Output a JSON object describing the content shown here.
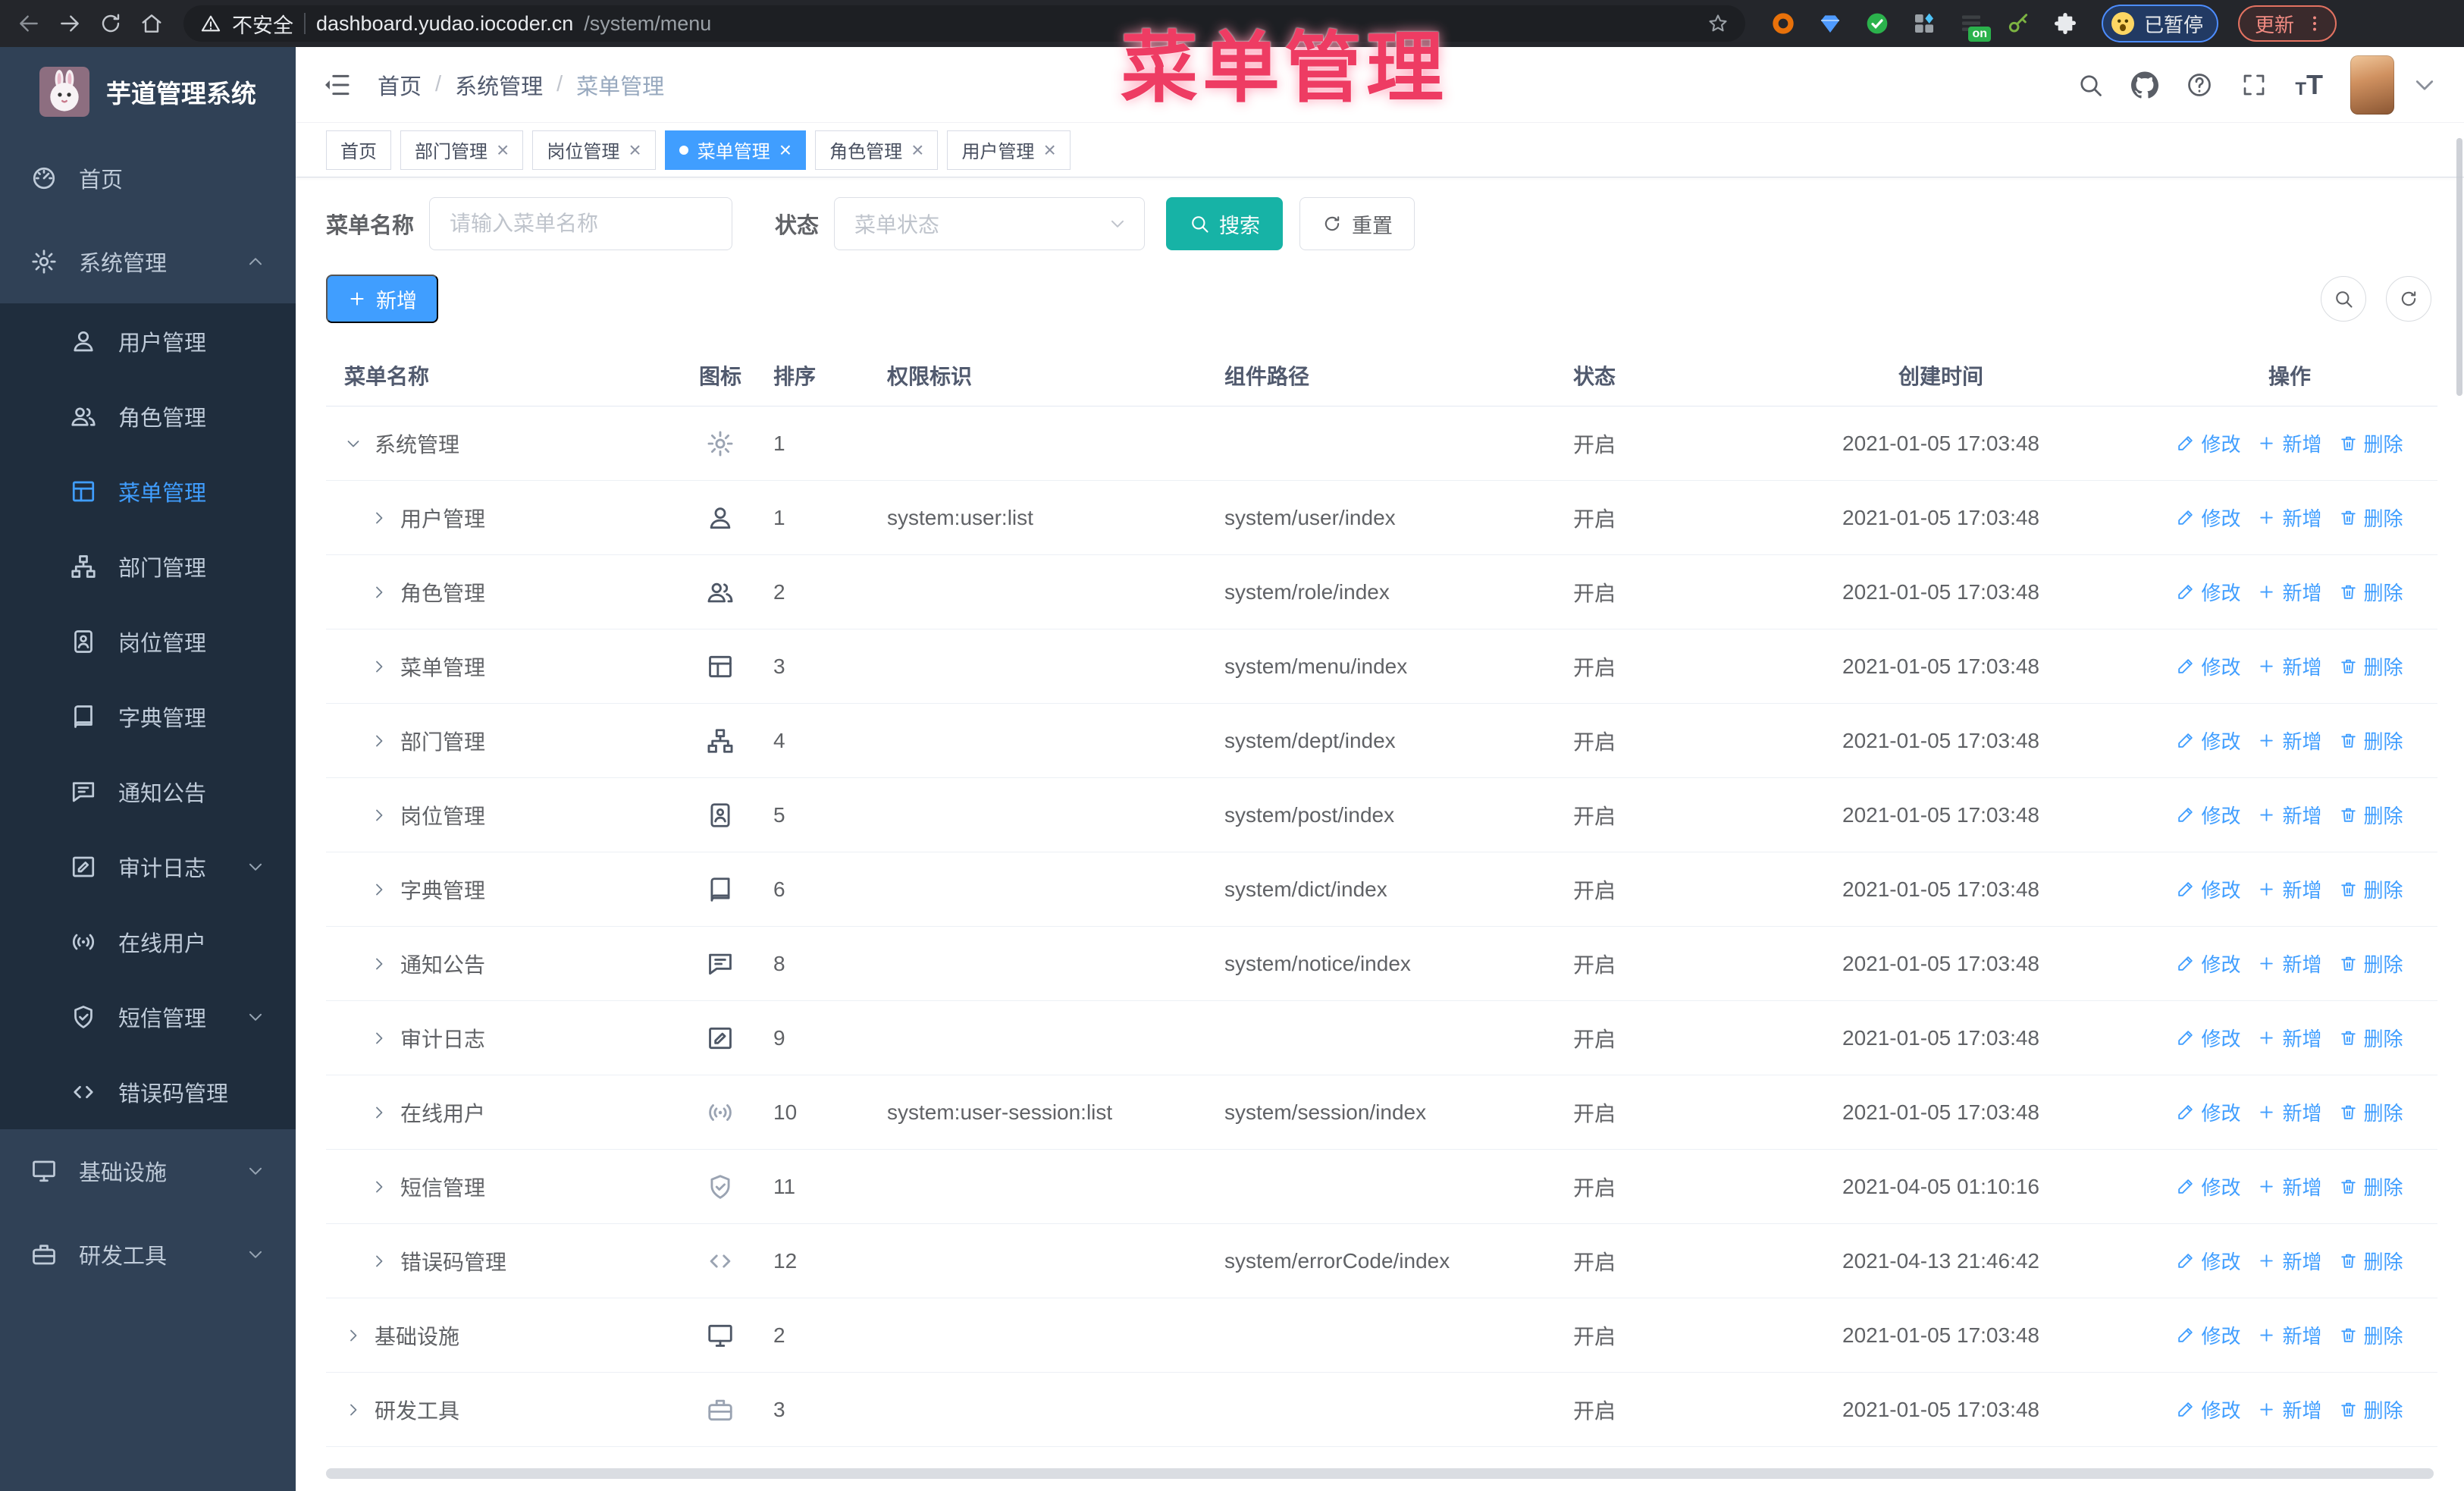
{
  "watermark": {
    "text": "菜单管理"
  },
  "browser": {
    "security_label": "不安全",
    "url_domain": "dashboard.yudao.iocoder.cn",
    "url_path": "/system/menu",
    "extension_badge": "on",
    "paused_chip": "已暂停",
    "update_button": "更新"
  },
  "sidebar": {
    "title": "芋道管理系统",
    "items": [
      {
        "id": "home",
        "label": "首页",
        "icon": "dashboard-icon",
        "sub": false
      },
      {
        "id": "system",
        "label": "系统管理",
        "icon": "gear-icon",
        "sub": false,
        "caret": "up"
      },
      {
        "id": "user",
        "label": "用户管理",
        "icon": "user-icon",
        "sub": true
      },
      {
        "id": "role",
        "label": "角色管理",
        "icon": "users-icon",
        "sub": true
      },
      {
        "id": "menu",
        "label": "菜单管理",
        "icon": "menu-tree-icon",
        "sub": true,
        "active": true
      },
      {
        "id": "dept",
        "label": "部门管理",
        "icon": "org-tree-icon",
        "sub": true
      },
      {
        "id": "post",
        "label": "岗位管理",
        "icon": "badge-icon",
        "sub": true
      },
      {
        "id": "dict",
        "label": "字典管理",
        "icon": "dict-icon",
        "sub": true
      },
      {
        "id": "notice",
        "label": "通知公告",
        "icon": "message-icon",
        "sub": true
      },
      {
        "id": "auditlog",
        "label": "审计日志",
        "icon": "log-icon",
        "sub": true,
        "caret": "down"
      },
      {
        "id": "online",
        "label": "在线用户",
        "icon": "online-icon",
        "sub": true
      },
      {
        "id": "sms",
        "label": "短信管理",
        "icon": "shield-icon",
        "sub": true,
        "caret": "down"
      },
      {
        "id": "errorcode",
        "label": "错误码管理",
        "icon": "code-icon",
        "sub": true
      },
      {
        "id": "infra",
        "label": "基础设施",
        "icon": "infra-icon",
        "sub": false,
        "caret": "down"
      },
      {
        "id": "tool",
        "label": "研发工具",
        "icon": "tool-icon",
        "sub": false,
        "caret": "down"
      }
    ]
  },
  "topbar": {
    "breadcrumb": [
      "首页",
      "系统管理",
      "菜单管理"
    ]
  },
  "tags": {
    "items": [
      {
        "id": "home",
        "label": "首页",
        "closable": false,
        "active": false
      },
      {
        "id": "dept",
        "label": "部门管理",
        "closable": true,
        "active": false
      },
      {
        "id": "post",
        "label": "岗位管理",
        "closable": true,
        "active": false
      },
      {
        "id": "menu",
        "label": "菜单管理",
        "closable": true,
        "active": true
      },
      {
        "id": "role",
        "label": "角色管理",
        "closable": true,
        "active": false
      },
      {
        "id": "user",
        "label": "用户管理",
        "closable": true,
        "active": false
      }
    ]
  },
  "filters": {
    "name_label": "菜单名称",
    "name_placeholder": "请输入菜单名称",
    "status_label": "状态",
    "status_placeholder": "菜单状态",
    "search_label": "搜索",
    "reset_label": "重置",
    "add_label": "新增"
  },
  "table": {
    "columns": [
      "菜单名称",
      "图标",
      "排序",
      "权限标识",
      "组件路径",
      "状态",
      "创建时间",
      "操作"
    ],
    "actions": {
      "edit": "修改",
      "add": "新增",
      "del": "删除"
    },
    "rows": [
      {
        "indent": 0,
        "expand": "down",
        "name": "系统管理",
        "icon": "gear-icon",
        "muted": true,
        "sort": "1",
        "perm": "",
        "path": "",
        "status": "开启",
        "time": "2021-01-05 17:03:48"
      },
      {
        "indent": 1,
        "expand": "right",
        "name": "用户管理",
        "icon": "user-icon",
        "muted": false,
        "sort": "1",
        "perm": "system:user:list",
        "path": "system/user/index",
        "status": "开启",
        "time": "2021-01-05 17:03:48"
      },
      {
        "indent": 1,
        "expand": "right",
        "name": "角色管理",
        "icon": "users-icon",
        "muted": false,
        "sort": "2",
        "perm": "",
        "path": "system/role/index",
        "status": "开启",
        "time": "2021-01-05 17:03:48"
      },
      {
        "indent": 1,
        "expand": "right",
        "name": "菜单管理",
        "icon": "menu-tree-icon",
        "muted": false,
        "sort": "3",
        "perm": "",
        "path": "system/menu/index",
        "status": "开启",
        "time": "2021-01-05 17:03:48"
      },
      {
        "indent": 1,
        "expand": "right",
        "name": "部门管理",
        "icon": "org-tree-icon",
        "muted": false,
        "sort": "4",
        "perm": "",
        "path": "system/dept/index",
        "status": "开启",
        "time": "2021-01-05 17:03:48"
      },
      {
        "indent": 1,
        "expand": "right",
        "name": "岗位管理",
        "icon": "badge-icon",
        "muted": false,
        "sort": "5",
        "perm": "",
        "path": "system/post/index",
        "status": "开启",
        "time": "2021-01-05 17:03:48"
      },
      {
        "indent": 1,
        "expand": "right",
        "name": "字典管理",
        "icon": "dict-icon",
        "muted": false,
        "sort": "6",
        "perm": "",
        "path": "system/dict/index",
        "status": "开启",
        "time": "2021-01-05 17:03:48"
      },
      {
        "indent": 1,
        "expand": "right",
        "name": "通知公告",
        "icon": "message-icon",
        "muted": false,
        "sort": "8",
        "perm": "",
        "path": "system/notice/index",
        "status": "开启",
        "time": "2021-01-05 17:03:48"
      },
      {
        "indent": 1,
        "expand": "right",
        "name": "审计日志",
        "icon": "log-icon",
        "muted": false,
        "sort": "9",
        "perm": "",
        "path": "",
        "status": "开启",
        "time": "2021-01-05 17:03:48"
      },
      {
        "indent": 1,
        "expand": "right",
        "name": "在线用户",
        "icon": "online-icon",
        "muted": true,
        "sort": "10",
        "perm": "system:user-session:list",
        "path": "system/session/index",
        "status": "开启",
        "time": "2021-01-05 17:03:48"
      },
      {
        "indent": 1,
        "expand": "right",
        "name": "短信管理",
        "icon": "shield-icon",
        "muted": true,
        "sort": "11",
        "perm": "",
        "path": "",
        "status": "开启",
        "time": "2021-04-05 01:10:16"
      },
      {
        "indent": 1,
        "expand": "right",
        "name": "错误码管理",
        "icon": "code-icon",
        "muted": true,
        "sort": "12",
        "perm": "",
        "path": "system/errorCode/index",
        "status": "开启",
        "time": "2021-04-13 21:46:42"
      },
      {
        "indent": 0,
        "expand": "right",
        "name": "基础设施",
        "icon": "infra-icon",
        "muted": false,
        "sort": "2",
        "perm": "",
        "path": "",
        "status": "开启",
        "time": "2021-01-05 17:03:48"
      },
      {
        "indent": 0,
        "expand": "right",
        "name": "研发工具",
        "icon": "tool-icon",
        "muted": true,
        "sort": "3",
        "perm": "",
        "path": "",
        "status": "开启",
        "time": "2021-01-05 17:03:48"
      }
    ]
  },
  "colors": {
    "accent": "#409eff",
    "search_teal": "#17b3a6",
    "sidebar_bg": "#304156",
    "submenu_bg": "#1f2d3d",
    "watermark_pink": "#ee3c63"
  }
}
